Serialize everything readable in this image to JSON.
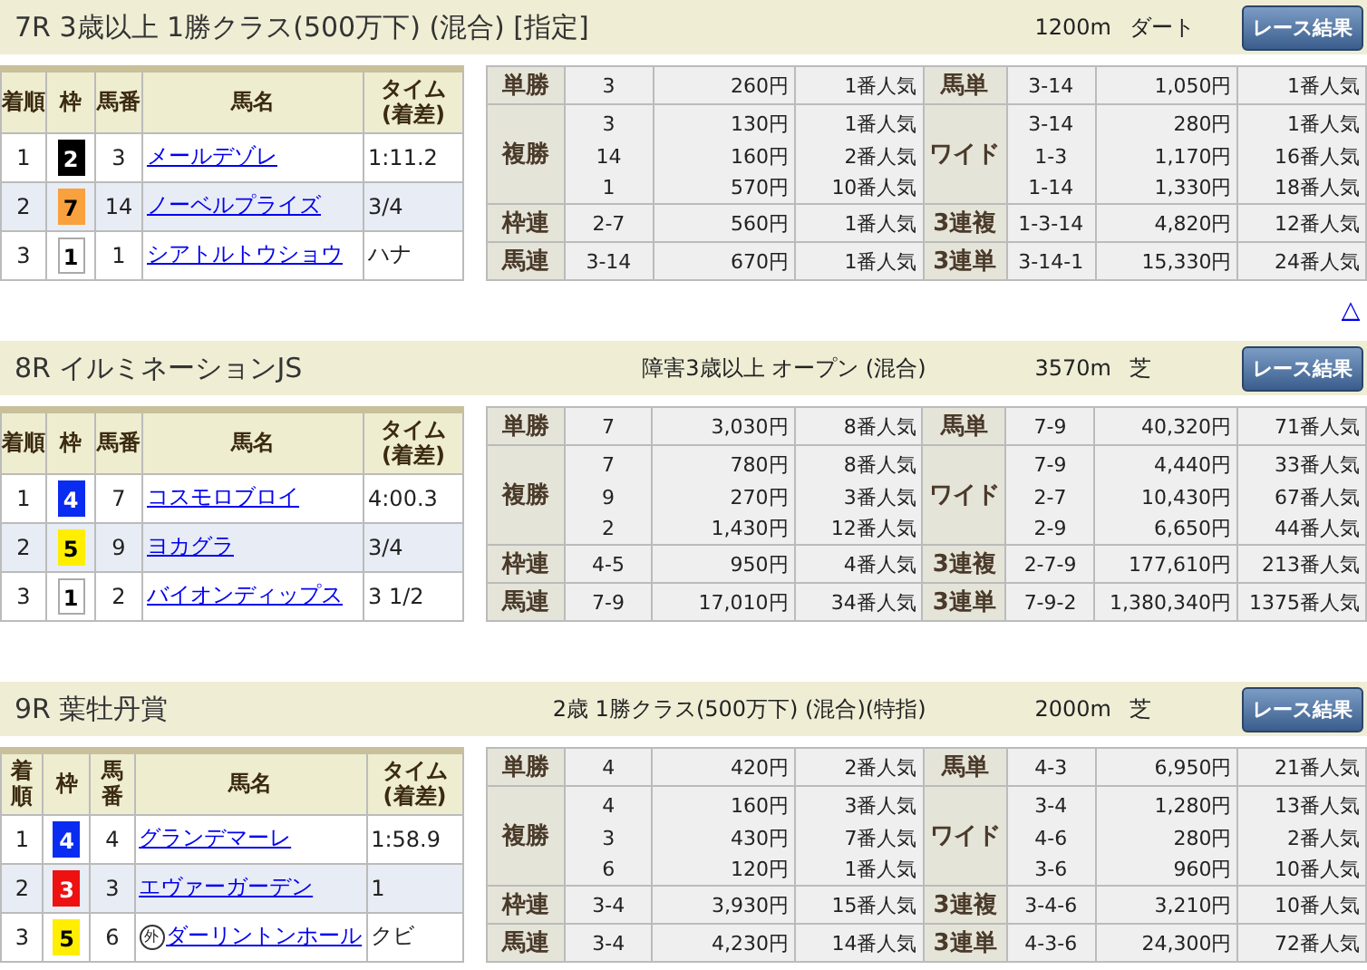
{
  "races": [
    {
      "title": "7R 3歳以上 1勝クラス(500万下) (混合) [指定]",
      "distance": "1200m",
      "surface": "ダート",
      "button": "レース結果",
      "to_top": "△",
      "result_columns": [
        "着順",
        "枠",
        "馬番",
        "馬名",
        "タイム (着差)"
      ],
      "results": [
        {
          "place": "1",
          "frame": "2",
          "color": "#000000",
          "number": "3",
          "name": "メールデゾレ",
          "time": "1:11.2"
        },
        {
          "place": "2",
          "frame": "7",
          "color": "#f9a03f",
          "number": "14",
          "name": "ノーベルプライズ",
          "time": "3/4"
        },
        {
          "place": "3",
          "frame": "1",
          "color": "#ffffff",
          "number": "1",
          "name": "シアトルトウショウ",
          "time": "ハナ"
        }
      ],
      "payouts": [
        {
          "left": {
            "type": "単勝",
            "entries": [
              {
                "combo": "3",
                "amount": "260円",
                "popularity": "1番人気"
              }
            ]
          },
          "right": {
            "type": "馬単",
            "entries": [
              {
                "combo": "3-14",
                "amount": "1,050円",
                "popularity": "1番人気"
              }
            ]
          }
        },
        {
          "left": {
            "type": "複勝",
            "entries": [
              {
                "combo": "3",
                "amount": "130円",
                "popularity": "1番人気"
              },
              {
                "combo": "14",
                "amount": "160円",
                "popularity": "2番人気"
              },
              {
                "combo": "1",
                "amount": "570円",
                "popularity": "10番人気"
              }
            ]
          },
          "right": {
            "type": "ワイド",
            "entries": [
              {
                "combo": "3-14",
                "amount": "280円",
                "popularity": "1番人気"
              },
              {
                "combo": "1-3",
                "amount": "1,170円",
                "popularity": "16番人気"
              },
              {
                "combo": "1-14",
                "amount": "1,330円",
                "popularity": "18番人気"
              }
            ]
          }
        },
        {
          "left": {
            "type": "枠連",
            "entries": [
              {
                "combo": "2-7",
                "amount": "560円",
                "popularity": "1番人気"
              }
            ]
          },
          "right": {
            "type": "3連複",
            "entries": [
              {
                "combo": "1-3-14",
                "amount": "4,820円",
                "popularity": "12番人気"
              }
            ]
          }
        },
        {
          "left": {
            "type": "馬連",
            "entries": [
              {
                "combo": "3-14",
                "amount": "670円",
                "popularity": "1番人気"
              }
            ]
          },
          "right": {
            "type": "3連単",
            "entries": [
              {
                "combo": "3-14-1",
                "amount": "15,330円",
                "popularity": "24番人気"
              }
            ]
          }
        }
      ]
    },
    {
      "title": "8R イルミネーションJS",
      "conditions": "障害3歳以上 オープン (混合)",
      "distance": "3570m",
      "surface": "芝",
      "button": "レース結果",
      "result_columns": [
        "着順",
        "枠",
        "馬番",
        "馬名",
        "タイム (着差)"
      ],
      "results": [
        {
          "place": "1",
          "frame": "4",
          "color": "#0a2cf0",
          "number": "7",
          "name": "コスモロブロイ",
          "time": "4:00.3"
        },
        {
          "place": "2",
          "frame": "5",
          "color": "#ffee00",
          "number": "9",
          "name": "ヨカグラ",
          "time": "3/4"
        },
        {
          "place": "3",
          "frame": "1",
          "color": "#ffffff",
          "number": "2",
          "name": "バイオンディップス",
          "time": "3 1/2"
        }
      ],
      "payouts": [
        {
          "left": {
            "type": "単勝",
            "entries": [
              {
                "combo": "7",
                "amount": "3,030円",
                "popularity": "8番人気"
              }
            ]
          },
          "right": {
            "type": "馬単",
            "entries": [
              {
                "combo": "7-9",
                "amount": "40,320円",
                "popularity": "71番人気"
              }
            ]
          }
        },
        {
          "left": {
            "type": "複勝",
            "entries": [
              {
                "combo": "7",
                "amount": "780円",
                "popularity": "8番人気"
              },
              {
                "combo": "9",
                "amount": "270円",
                "popularity": "3番人気"
              },
              {
                "combo": "2",
                "amount": "1,430円",
                "popularity": "12番人気"
              }
            ]
          },
          "right": {
            "type": "ワイド",
            "entries": [
              {
                "combo": "7-9",
                "amount": "4,440円",
                "popularity": "33番人気"
              },
              {
                "combo": "2-7",
                "amount": "10,430円",
                "popularity": "67番人気"
              },
              {
                "combo": "2-9",
                "amount": "6,650円",
                "popularity": "44番人気"
              }
            ]
          }
        },
        {
          "left": {
            "type": "枠連",
            "entries": [
              {
                "combo": "4-5",
                "amount": "950円",
                "popularity": "4番人気"
              }
            ]
          },
          "right": {
            "type": "3連複",
            "entries": [
              {
                "combo": "2-7-9",
                "amount": "177,610円",
                "popularity": "213番人気"
              }
            ]
          }
        },
        {
          "left": {
            "type": "馬連",
            "entries": [
              {
                "combo": "7-9",
                "amount": "17,010円",
                "popularity": "34番人気"
              }
            ]
          },
          "right": {
            "type": "3連単",
            "entries": [
              {
                "combo": "7-9-2",
                "amount": "1,380,340円",
                "popularity": "1375番人気"
              }
            ]
          }
        }
      ]
    },
    {
      "title": "9R 葉牡丹賞",
      "conditions": "2歳 1勝クラス(500万下) (混合)(特指)",
      "distance": "2000m",
      "surface": "芝",
      "button": "レース結果",
      "result_columns": [
        "着順",
        "枠",
        "馬番",
        "馬名",
        "タイム (着差)"
      ],
      "results": [
        {
          "place": "1",
          "frame": "4",
          "color": "#0a2cf0",
          "number": "4",
          "name": "グランデマーレ",
          "time": "1:58.9"
        },
        {
          "place": "2",
          "frame": "3",
          "color": "#ee1111",
          "number": "3",
          "name": "エヴァーガーデン",
          "time": "1"
        },
        {
          "place": "3",
          "frame": "5",
          "color": "#ffee00",
          "number": "6",
          "mark": "外",
          "name": "ダーリントンホール",
          "time": "クビ"
        }
      ],
      "payouts": [
        {
          "left": {
            "type": "単勝",
            "entries": [
              {
                "combo": "4",
                "amount": "420円",
                "popularity": "2番人気"
              }
            ]
          },
          "right": {
            "type": "馬単",
            "entries": [
              {
                "combo": "4-3",
                "amount": "6,950円",
                "popularity": "21番人気"
              }
            ]
          }
        },
        {
          "left": {
            "type": "複勝",
            "entries": [
              {
                "combo": "4",
                "amount": "160円",
                "popularity": "3番人気"
              },
              {
                "combo": "3",
                "amount": "430円",
                "popularity": "7番人気"
              },
              {
                "combo": "6",
                "amount": "120円",
                "popularity": "1番人気"
              }
            ]
          },
          "right": {
            "type": "ワイド",
            "entries": [
              {
                "combo": "3-4",
                "amount": "1,280円",
                "popularity": "13番人気"
              },
              {
                "combo": "4-6",
                "amount": "280円",
                "popularity": "2番人気"
              },
              {
                "combo": "3-6",
                "amount": "960円",
                "popularity": "10番人気"
              }
            ]
          }
        },
        {
          "left": {
            "type": "枠連",
            "entries": [
              {
                "combo": "3-4",
                "amount": "3,930円",
                "popularity": "15番人気"
              }
            ]
          },
          "right": {
            "type": "3連複",
            "entries": [
              {
                "combo": "3-4-6",
                "amount": "3,210円",
                "popularity": "10番人気"
              }
            ]
          }
        },
        {
          "left": {
            "type": "馬連",
            "entries": [
              {
                "combo": "3-4",
                "amount": "4,230円",
                "popularity": "14番人気"
              }
            ]
          },
          "right": {
            "type": "3連単",
            "entries": [
              {
                "combo": "4-3-6",
                "amount": "24,300円",
                "popularity": "72番人気"
              }
            ]
          }
        }
      ]
    }
  ]
}
